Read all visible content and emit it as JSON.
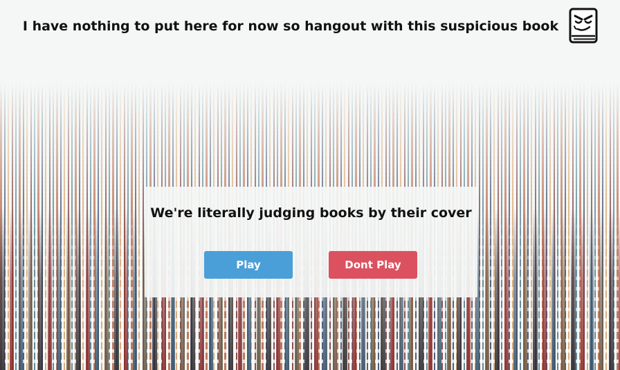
{
  "header": {
    "title": "I have nothing to put here for now so hangout with this suspicious book",
    "icon": "suspicious-book-icon"
  },
  "card": {
    "title": "We're literally judging books by their cover",
    "play_label": "Play",
    "dont_play_label": "Dont Play"
  },
  "colors": {
    "play_button": "#4a9fd8",
    "dont_play_button": "#dc5160",
    "text": "#111111"
  }
}
